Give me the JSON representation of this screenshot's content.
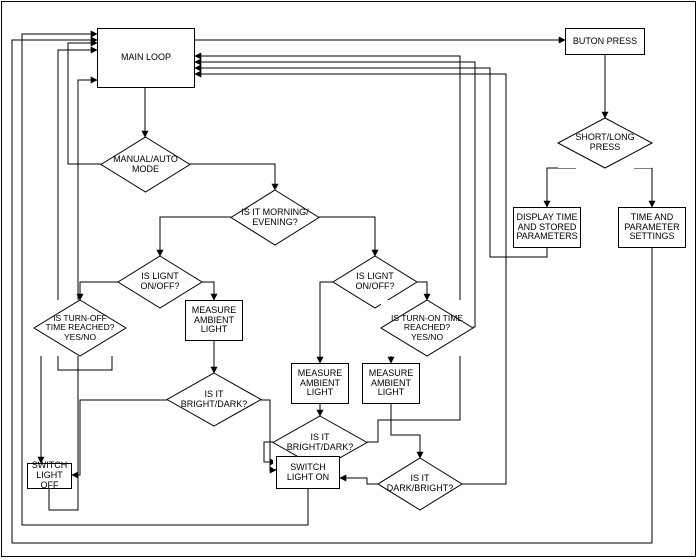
{
  "nodes": {
    "main_loop": "MAIN LOOP",
    "button_press": "BUTON PRESS",
    "short_long_press": "SHORT/LONG PRESS",
    "display_time": "DISPLAY TIME AND STORED PARAMETERS",
    "time_settings": "TIME AND PARAMETER SETTINGS",
    "manual_auto": "MANUAL/AUTO MODE",
    "is_morning": "IS IT MORNING/ EVENING?",
    "is_light_onoff_left": "IS LIGNT ON/OFF?",
    "is_light_onoff_right": "IS LIGNT ON/OFF?",
    "turnoff_reached": "IS TURN-OFF TIME REACHED? YES/NO",
    "turnon_reached": "IS TURN-ON TIME REACHED? YES/NO",
    "measure_left": "MEASURE AMBIENT LIGHT",
    "measure_mid": "MEASURE AMBIENT LIGHT",
    "measure_right": "MEASURE AMBIENT LIGHT",
    "is_bright_dark1": "IS IT BRIGHT/DARK?",
    "is_bright_dark2": "IS IT BRIGHT/DARK?",
    "is_dark_bright": "IS IT DARK/BRIGHT?",
    "switch_off": "SWITCH LIGHT OFF",
    "switch_on": "SWITCH LIGHT ON"
  },
  "chart_data": {
    "type": "flowchart",
    "nodes": [
      {
        "id": "main_loop",
        "shape": "process",
        "label": "MAIN LOOP"
      },
      {
        "id": "button_press",
        "shape": "process",
        "label": "BUTON PRESS"
      },
      {
        "id": "short_long_press",
        "shape": "decision",
        "label": "SHORT/LONG PRESS"
      },
      {
        "id": "display_time",
        "shape": "process",
        "label": "DISPLAY TIME AND STORED PARAMETERS"
      },
      {
        "id": "time_settings",
        "shape": "process",
        "label": "TIME AND PARAMETER SETTINGS"
      },
      {
        "id": "manual_auto",
        "shape": "decision",
        "label": "MANUAL/AUTO MODE"
      },
      {
        "id": "is_morning",
        "shape": "decision",
        "label": "IS IT MORNING/EVENING?"
      },
      {
        "id": "is_light_onoff_left",
        "shape": "decision",
        "label": "IS LIGNT ON/OFF?"
      },
      {
        "id": "is_light_onoff_right",
        "shape": "decision",
        "label": "IS LIGNT ON/OFF?"
      },
      {
        "id": "turnoff_reached",
        "shape": "decision",
        "label": "IS TURN-OFF TIME REACHED? YES/NO"
      },
      {
        "id": "turnon_reached",
        "shape": "decision",
        "label": "IS TURN-ON TIME REACHED? YES/NO"
      },
      {
        "id": "measure_left",
        "shape": "process",
        "label": "MEASURE AMBIENT LIGHT"
      },
      {
        "id": "measure_mid",
        "shape": "process",
        "label": "MEASURE AMBIENT LIGHT"
      },
      {
        "id": "measure_right",
        "shape": "process",
        "label": "MEASURE AMBIENT LIGHT"
      },
      {
        "id": "is_bright_dark1",
        "shape": "decision",
        "label": "IS IT BRIGHT/DARK?"
      },
      {
        "id": "is_bright_dark2",
        "shape": "decision",
        "label": "IS IT BRIGHT/DARK?"
      },
      {
        "id": "is_dark_bright",
        "shape": "decision",
        "label": "IS IT DARK/BRIGHT?"
      },
      {
        "id": "switch_off",
        "shape": "process",
        "label": "SWITCH LIGHT OFF"
      },
      {
        "id": "switch_on",
        "shape": "process",
        "label": "SWITCH LIGHT ON"
      }
    ],
    "edges": [
      {
        "from": "main_loop",
        "to": "button_press"
      },
      {
        "from": "button_press",
        "to": "short_long_press"
      },
      {
        "from": "short_long_press",
        "to": "display_time"
      },
      {
        "from": "short_long_press",
        "to": "time_settings"
      },
      {
        "from": "display_time",
        "to": "main_loop"
      },
      {
        "from": "time_settings",
        "to": "main_loop"
      },
      {
        "from": "main_loop",
        "to": "manual_auto"
      },
      {
        "from": "manual_auto",
        "to": "main_loop"
      },
      {
        "from": "manual_auto",
        "to": "is_morning"
      },
      {
        "from": "is_morning",
        "to": "is_light_onoff_left"
      },
      {
        "from": "is_morning",
        "to": "is_light_onoff_right"
      },
      {
        "from": "is_light_onoff_left",
        "to": "turnoff_reached"
      },
      {
        "from": "is_light_onoff_left",
        "to": "measure_left"
      },
      {
        "from": "is_light_onoff_right",
        "to": "measure_mid"
      },
      {
        "from": "is_light_onoff_right",
        "to": "turnon_reached"
      },
      {
        "from": "turnoff_reached",
        "to": "switch_off"
      },
      {
        "from": "turnoff_reached",
        "to": "main_loop"
      },
      {
        "from": "turnon_reached",
        "to": "measure_right"
      },
      {
        "from": "turnon_reached",
        "to": "main_loop"
      },
      {
        "from": "measure_left",
        "to": "is_bright_dark1"
      },
      {
        "from": "measure_mid",
        "to": "is_bright_dark2"
      },
      {
        "from": "measure_right",
        "to": "is_dark_bright"
      },
      {
        "from": "is_bright_dark1",
        "to": "switch_off"
      },
      {
        "from": "is_bright_dark1",
        "to": "switch_on"
      },
      {
        "from": "is_bright_dark2",
        "to": "switch_on"
      },
      {
        "from": "is_bright_dark2",
        "to": "main_loop"
      },
      {
        "from": "is_dark_bright",
        "to": "switch_on"
      },
      {
        "from": "is_dark_bright",
        "to": "main_loop"
      },
      {
        "from": "switch_off",
        "to": "main_loop"
      },
      {
        "from": "switch_on",
        "to": "main_loop"
      }
    ]
  }
}
